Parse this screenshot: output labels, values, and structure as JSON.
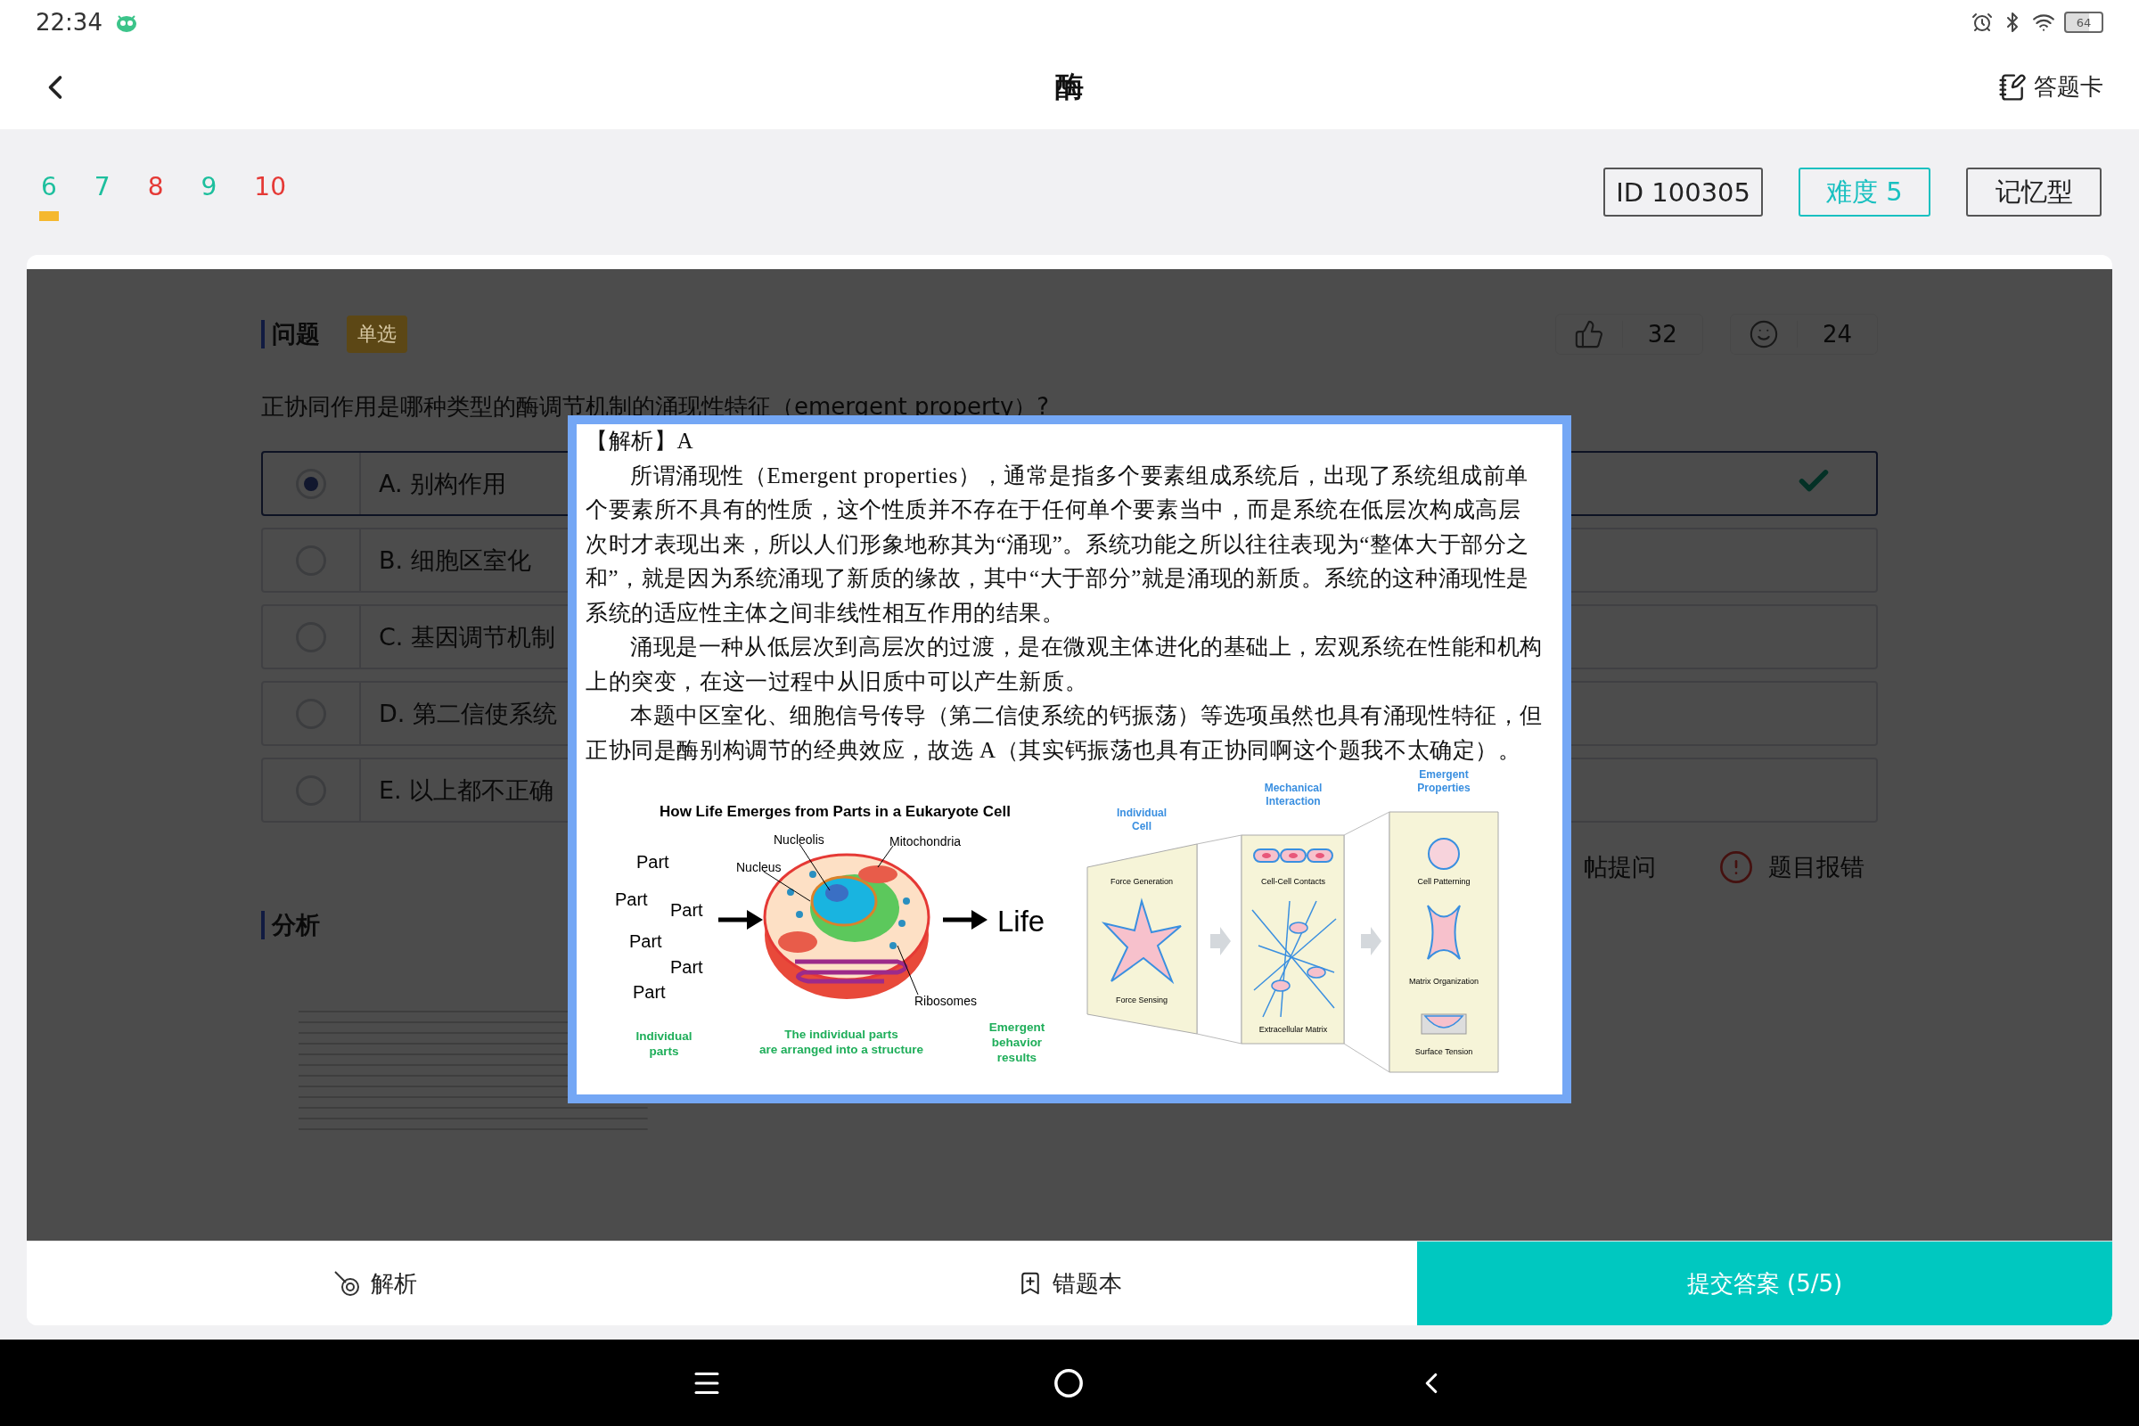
{
  "status_bar": {
    "time": "22:34",
    "battery": "64"
  },
  "header": {
    "title": "酶",
    "answer_sheet": "答题卡"
  },
  "question_nav": [
    {
      "label": "6",
      "selected": true,
      "color": "#1dbf9d"
    },
    {
      "label": "7",
      "selected": false,
      "color": "#1dbf9d"
    },
    {
      "label": "8",
      "selected": false,
      "color": "#e53935"
    },
    {
      "label": "9",
      "selected": false,
      "color": "#1dbf9d"
    },
    {
      "label": "10",
      "selected": false,
      "color": "#e53935"
    }
  ],
  "tags": {
    "id": "ID 100305",
    "difficulty": "难度 5",
    "type": "记忆型"
  },
  "question": {
    "heading": "问题",
    "tag": "单选",
    "likes": "32",
    "smiles": "24",
    "text": "正协同作用是哪种类型的酶调节机制的涌现性特征（emergent property）?",
    "options": [
      {
        "label": "A. 别构作用",
        "selected": true,
        "correct": true
      },
      {
        "label": "B. 细胞区室化",
        "selected": false,
        "correct": false
      },
      {
        "label": "C. 基因调节机制",
        "selected": false,
        "correct": false
      },
      {
        "label": "D. 第二信使系统",
        "selected": false,
        "correct": false
      },
      {
        "label": "E. 以上都不正确",
        "selected": false,
        "correct": false
      }
    ]
  },
  "actions": {
    "ask": "帖提问",
    "report": "题目报错"
  },
  "analysis": {
    "heading": "分析"
  },
  "bottom_bar": {
    "analysis": "解析",
    "wrong_book": "错题本",
    "submit": "提交答案 (5/5)"
  },
  "preview": {
    "heading": "【解析】A",
    "paragraphs": [
      "所谓涌现性（Emergent properties），通常是指多个要素组成系统后，出现了系统组成前单个要素所不具有的性质，这个性质并不存在于任何单个要素当中，而是系统在低层次构成高层次时才表现出来，所以人们形象地称其为“涌现”。系统功能之所以往往表现为“整体大于部分之和”，就是因为系统涌现了新质的缘故，其中“大于部分”就是涌现的新质。系统的这种涌现性是系统的适应性主体之间非线性相互作用的结果。",
      "涌现是一种从低层次到高层次的过渡，是在微观主体进化的基础上，宏观系统在性能和机构上的突变，在这一过程中从旧质中可以产生新质。",
      "本题中区室化、细胞信号传导（第二信使系统的钙振荡）等选项虽然也具有涌现性特征，但正协同是酶别构调节的经典效应，故选 A（其实钙振荡也具有正协同啊这个题我不太确定）。"
    ],
    "figure": {
      "title": "How Life Emerges from Parts in a Eukaryote Cell",
      "parts": [
        "Part",
        "Part",
        "Part",
        "Part",
        "Part",
        "Part"
      ],
      "organelles": [
        "Nucleolis",
        "Mitochondria",
        "Nucleus",
        "Ribosomes"
      ],
      "result": "Life",
      "captions": [
        [
          "Individual",
          "parts"
        ],
        [
          "The individual parts",
          "are arranged into a structure"
        ],
        [
          "Emergent",
          "behavior",
          "results"
        ]
      ],
      "panels": [
        {
          "heading": [
            "Individual",
            "Cell"
          ],
          "labels": [
            "Force Generation",
            "Force Sensing"
          ]
        },
        {
          "heading": [
            "Mechanical",
            "Interaction"
          ],
          "labels": [
            "Cell-Cell Contacts",
            "Extracellular Matrix"
          ]
        },
        {
          "heading": [
            "Emergent",
            "Properties"
          ],
          "labels": [
            "Cell Patterning",
            "Matrix Organization",
            "Surface Tension"
          ]
        }
      ]
    }
  }
}
